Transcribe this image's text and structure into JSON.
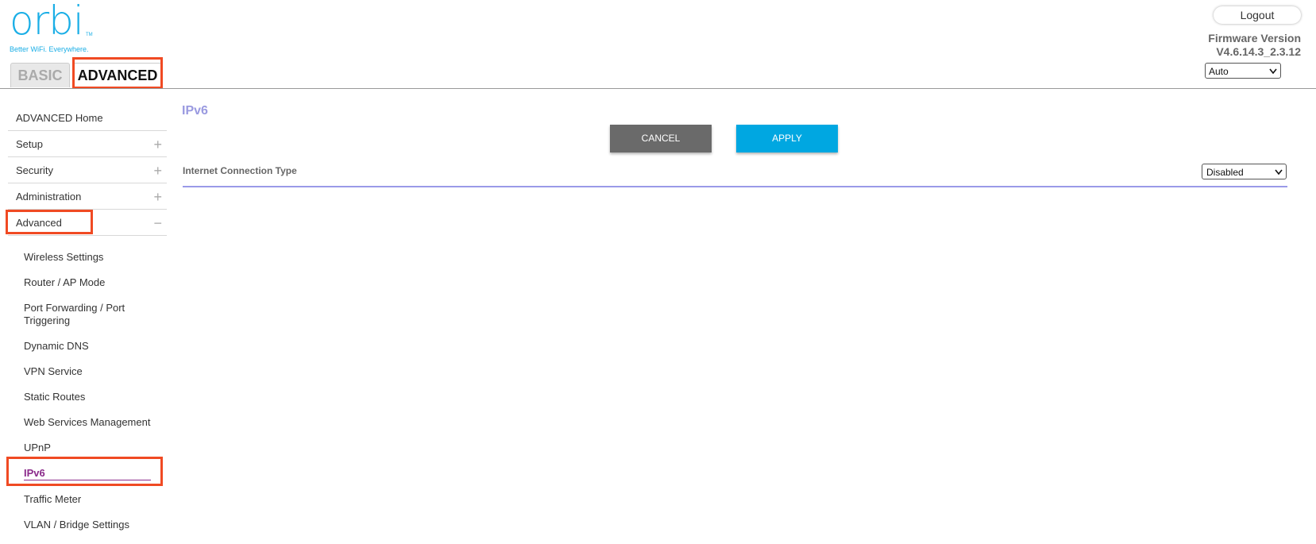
{
  "brand": {
    "logo_text": "orbi",
    "trademark": "TM",
    "tagline": "Better WiFi. Everywhere."
  },
  "tabs": {
    "basic": "BASIC",
    "advanced": "ADVANCED"
  },
  "header": {
    "logout_label": "Logout",
    "firmware_title": "Firmware Version",
    "firmware_value": "V4.6.14.3_2.3.12",
    "language_selected": "Auto"
  },
  "sidebar": {
    "items": [
      {
        "label": "ADVANCED Home",
        "sign": ""
      },
      {
        "label": "Setup",
        "sign": "+"
      },
      {
        "label": "Security",
        "sign": "+"
      },
      {
        "label": "Administration",
        "sign": "+"
      },
      {
        "label": "Advanced",
        "sign": "−"
      }
    ],
    "subitems": [
      "Wireless Settings",
      "Router / AP Mode",
      "Port Forwarding / Port Triggering",
      "Dynamic DNS",
      "VPN Service",
      "Static Routes",
      "Web Services Management",
      "UPnP",
      "IPv6",
      "Traffic Meter",
      "VLAN / Bridge Settings"
    ]
  },
  "main": {
    "title": "IPv6",
    "cancel_label": "CANCEL",
    "apply_label": "APPLY",
    "connection_type_label": "Internet Connection Type",
    "connection_type_value": "Disabled"
  },
  "colors": {
    "brand_blue": "#1aaee6",
    "highlight_red": "#f04a23",
    "active_purple": "#8a2a8a",
    "title_lavender": "#9a9ae0",
    "apply_blue": "#00a7e1"
  }
}
